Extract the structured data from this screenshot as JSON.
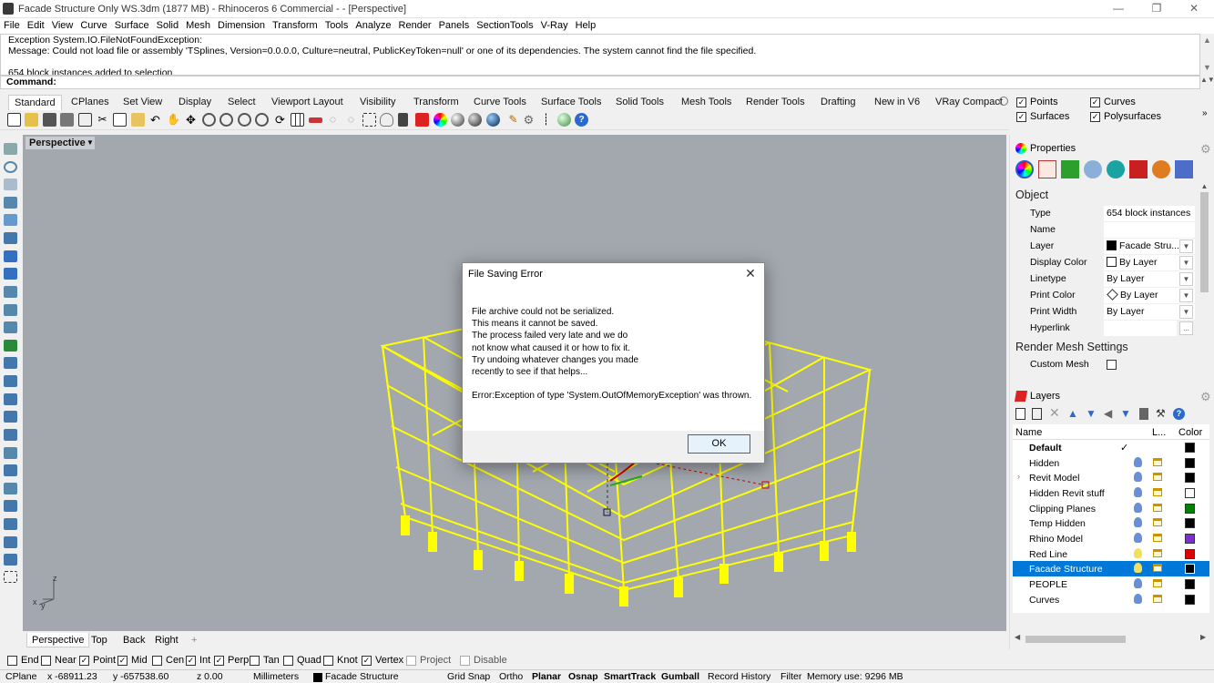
{
  "window": {
    "title": "Facade Structure Only WS.3dm (1877 MB) - Rhinoceros 6 Commercial - - [Perspective]"
  },
  "menu": [
    "File",
    "Edit",
    "View",
    "Curve",
    "Surface",
    "Solid",
    "Mesh",
    "Dimension",
    "Transform",
    "Tools",
    "Analyze",
    "Render",
    "Panels",
    "SectionTools",
    "V-Ray",
    "Help"
  ],
  "command": {
    "history": [
      "Exception System.IO.FileNotFoundException:",
      "Message: Could not load file or assembly 'TSplines, Version=0.0.0.0, Culture=neutral, PublicKeyToken=null' or one of its dependencies. The system cannot find the file specified.",
      "",
      "654 block instances added to selection."
    ],
    "prompt": "Command:"
  },
  "toolbar_tabs": [
    "Standard",
    "CPlanes",
    "Set View",
    "Display",
    "Select",
    "Viewport Layout",
    "Visibility",
    "Transform",
    "Curve Tools",
    "Surface Tools",
    "Solid Tools",
    "Mesh Tools",
    "Render Tools",
    "Drafting",
    "New in V6",
    "VRay Compact"
  ],
  "selection_filters": [
    {
      "label": "Points",
      "checked": true
    },
    {
      "label": "Curves",
      "checked": true
    },
    {
      "label": "Surfaces",
      "checked": true
    },
    {
      "label": "Polysurfaces",
      "checked": true
    }
  ],
  "viewport": {
    "name": "Perspective",
    "axis_z": "z",
    "axis_x": "x",
    "axis_y": "y"
  },
  "viewport_tabs": [
    "Perspective",
    "Top",
    "Back",
    "Right"
  ],
  "add_tab": "+",
  "properties": {
    "panel_title": "Properties",
    "section_object": "Object",
    "rows": [
      {
        "label": "Type",
        "value": "654 block instances"
      },
      {
        "label": "Name",
        "value": ""
      },
      {
        "label": "Layer",
        "value": "Facade Stru..."
      },
      {
        "label": "Display Color",
        "value": "By Layer"
      },
      {
        "label": "Linetype",
        "value": "By Layer"
      },
      {
        "label": "Print Color",
        "value": "By Layer"
      },
      {
        "label": "Print Width",
        "value": "By Layer"
      },
      {
        "label": "Hyperlink",
        "value": "..."
      }
    ],
    "section_render": "Render Mesh Settings",
    "custom_mesh_label": "Custom Mesh"
  },
  "layers": {
    "panel_title": "Layers",
    "col_name": "Name",
    "col_l": "L...",
    "col_color": "Color",
    "current_mark": "✓",
    "items": [
      {
        "name": "Default",
        "color": "#000000",
        "bold": true
      },
      {
        "name": "Hidden",
        "color": "#000000"
      },
      {
        "name": "Revit Model",
        "color": "#000000"
      },
      {
        "name": "Hidden Revit stuff",
        "color": "#ffffff"
      },
      {
        "name": "Clipping Planes",
        "color": "#008000"
      },
      {
        "name": "Temp Hidden",
        "color": "#000000"
      },
      {
        "name": "Rhino Model",
        "color": "#7a2fd0"
      },
      {
        "name": "Red Line",
        "color": "#e00000"
      },
      {
        "name": "Facade Structure",
        "color": "#000000",
        "selected": true
      },
      {
        "name": "PEOPLE",
        "color": "#000000"
      },
      {
        "name": "Curves",
        "color": "#000000"
      }
    ]
  },
  "osnap": [
    {
      "label": "End",
      "checked": false
    },
    {
      "label": "Near",
      "checked": false
    },
    {
      "label": "Point",
      "checked": true
    },
    {
      "label": "Mid",
      "checked": true
    },
    {
      "label": "Cen",
      "checked": false
    },
    {
      "label": "Int",
      "checked": true
    },
    {
      "label": "Perp",
      "checked": true
    },
    {
      "label": "Tan",
      "checked": false
    },
    {
      "label": "Quad",
      "checked": false
    },
    {
      "label": "Knot",
      "checked": false
    },
    {
      "label": "Vertex",
      "checked": true
    },
    {
      "label": "Project",
      "checked": false
    },
    {
      "label": "Disable",
      "checked": false
    }
  ],
  "status": {
    "cplane": "CPlane",
    "x": "x -68911.23",
    "y": "y -657538.60",
    "z": "z 0.00",
    "units": "Millimeters",
    "layer": "Facade Structure",
    "grid_snap": "Grid Snap",
    "ortho": "Ortho",
    "planar": "Planar",
    "osnap": "Osnap",
    "smarttrack": "SmartTrack",
    "gumball": "Gumball",
    "record_history": "Record History",
    "filter": "Filter",
    "memory": "Memory use: 9296 MB"
  },
  "dialog": {
    "title": "File Saving Error",
    "lines": [
      "File archive could not be serialized.",
      "This means it cannot be saved.",
      "The process failed very late and we do",
      "not know what caused it or how to fix it.",
      "Try undoing whatever changes you made",
      "recently to see if that helps..."
    ],
    "error": "Error:Exception of type 'System.OutOfMemoryException' was thrown.",
    "ok": "OK"
  },
  "colors": {
    "structure": "#ffff00",
    "selection": "#0078d7",
    "viewport_bg": "#a3a8af"
  }
}
